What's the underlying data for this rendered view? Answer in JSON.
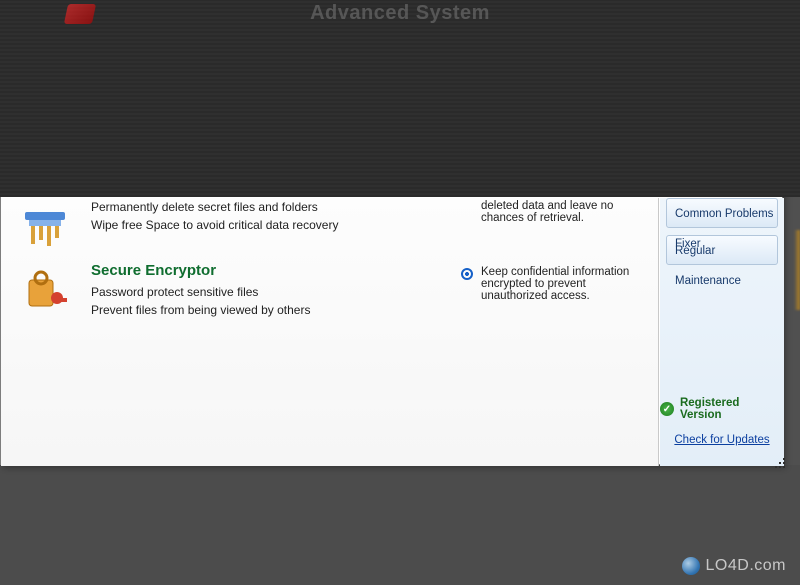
{
  "window": {
    "title": "Advanced System"
  },
  "features": {
    "shredder": {
      "line1": "Permanently delete secret files and folders",
      "line2": "Wipe free Space to avoid critical data recovery",
      "desc": "deleted data and leave no chances of retrieval."
    },
    "encryptor": {
      "title": "Secure Encryptor",
      "line1": "Password protect sensitive files",
      "line2": "Prevent files from being viewed by others",
      "desc": "Keep confidential information encrypted to prevent unauthorized access."
    }
  },
  "sidebar": {
    "buttons": [
      "Common Problems Fixer",
      "Regular Maintenance"
    ],
    "registered": "Registered Version",
    "update_link": "Check for Updates"
  },
  "watermark": "LO4D.com"
}
